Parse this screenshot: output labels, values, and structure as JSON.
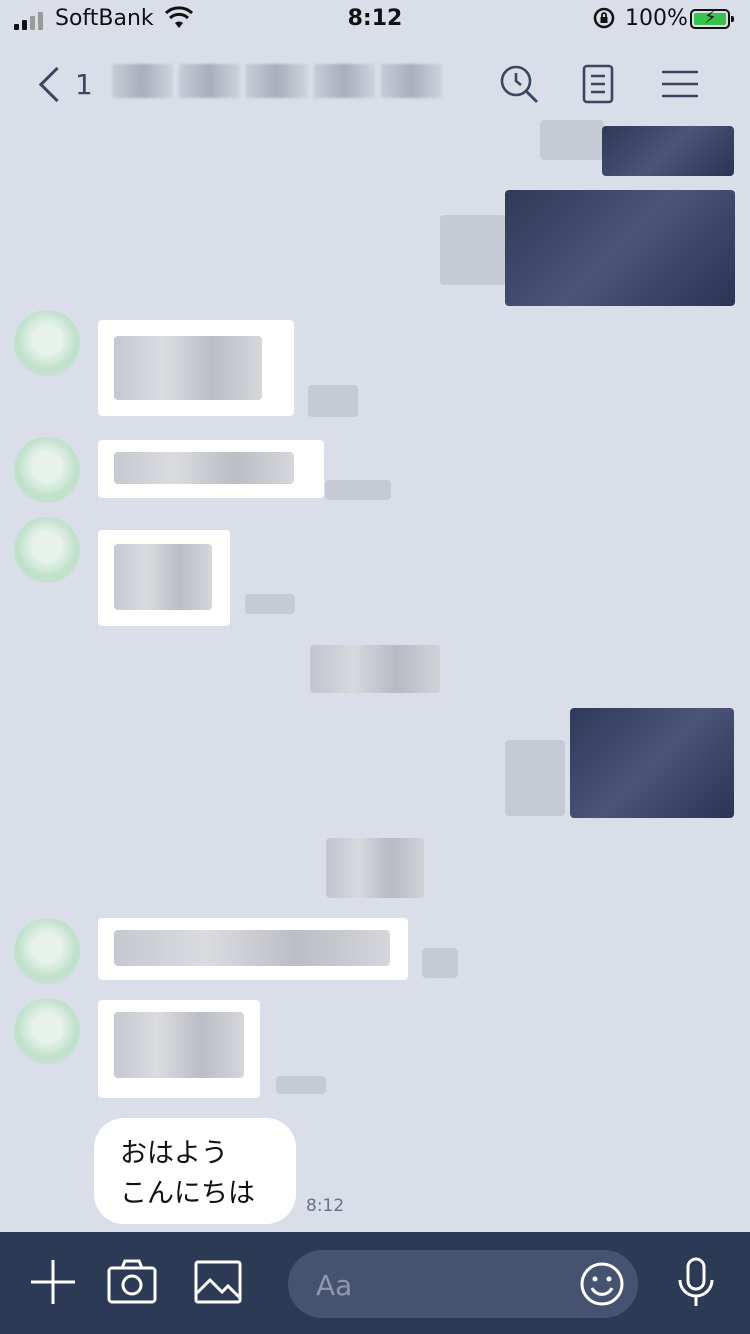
{
  "status_bar": {
    "carrier": "SoftBank",
    "time": "8:12",
    "battery": "100%",
    "battery_level": 1.0,
    "battery_color": "#37c14d"
  },
  "header": {
    "back_count": "1",
    "icons": [
      "search-icon",
      "notes-icon",
      "menu-icon"
    ]
  },
  "messages": {
    "last": {
      "lines": [
        "おはよう",
        "こんにちは"
      ],
      "time": "8:12"
    }
  },
  "input_bar": {
    "placeholder": "Aa",
    "icons": [
      "plus-icon",
      "camera-icon",
      "image-icon",
      "emoji-icon",
      "mic-icon"
    ]
  },
  "colors": {
    "background": "#d9dee9",
    "bottom_bar": "#2c3a56",
    "input_bg": "#455371",
    "sent_bubble": "#2f3a58"
  }
}
